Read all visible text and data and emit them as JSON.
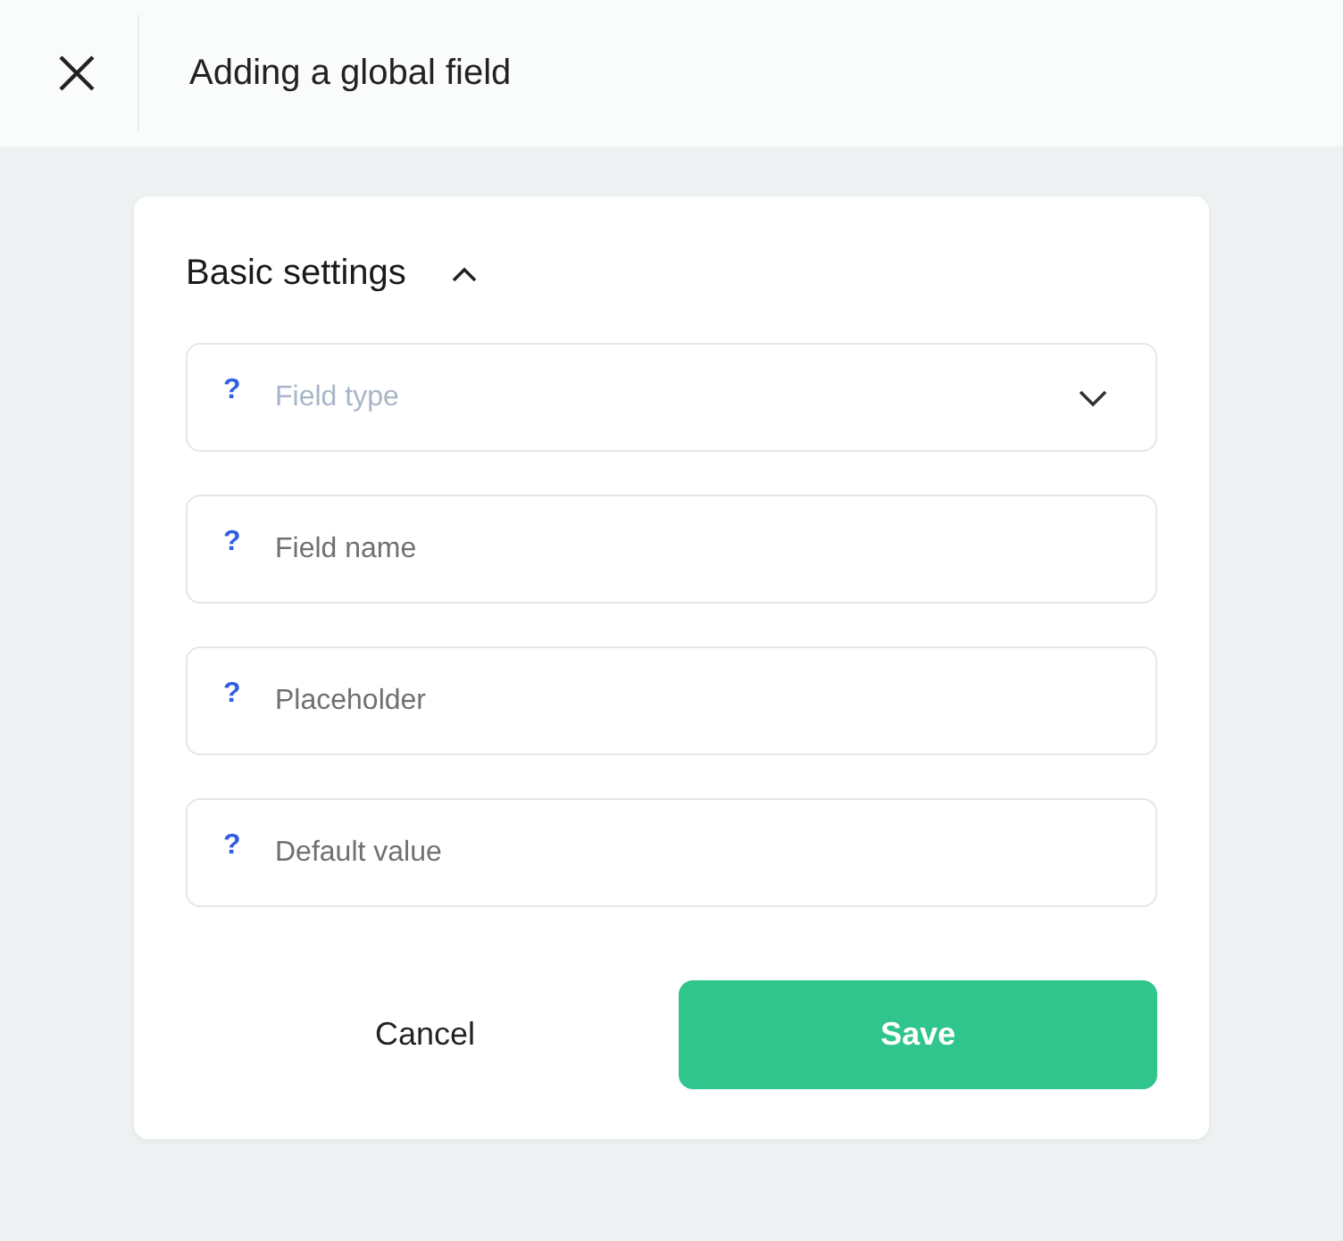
{
  "window": {
    "title": "Adding a global field"
  },
  "section": {
    "title": "Basic settings",
    "expanded": true
  },
  "fields": [
    {
      "kind": "select",
      "help": "?",
      "placeholder": "Field type"
    },
    {
      "kind": "text",
      "help": "?",
      "placeholder": "Field name"
    },
    {
      "kind": "text",
      "help": "?",
      "placeholder": "Placeholder"
    },
    {
      "kind": "text",
      "help": "?",
      "placeholder": "Default value"
    }
  ],
  "buttons": [
    {
      "kind": "secondary",
      "label": "Cancel"
    },
    {
      "kind": "primary",
      "label": "Save"
    }
  ]
}
